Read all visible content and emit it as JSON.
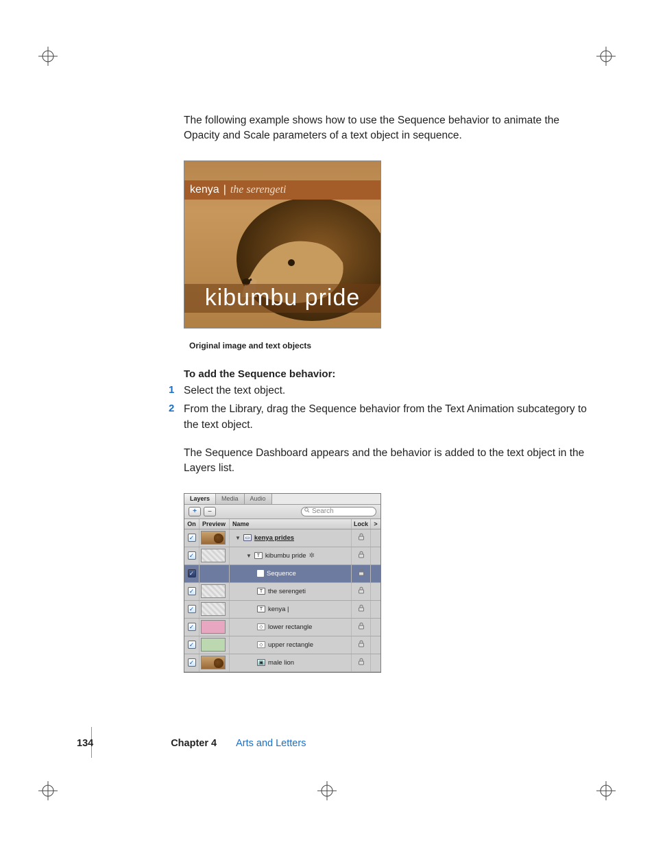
{
  "intro": "The following example shows how to use the Sequence behavior to animate the Opacity and Scale parameters of a text object in sequence.",
  "figure1": {
    "top_left": "kenya",
    "top_bar": "|",
    "top_right": "the serengeti",
    "bottom": "kibumbu pride",
    "caption": "Original image and text objects"
  },
  "heading": "To add the Sequence behavior:",
  "steps": [
    "Select the text object.",
    "From the Library, drag the Sequence behavior from the Text Animation subcategory to the text object."
  ],
  "post_para": "The Sequence Dashboard appears and the behavior is added to the text object in the Layers list.",
  "layers_panel": {
    "tabs": [
      "Layers",
      "Media",
      "Audio"
    ],
    "toolbar": {
      "add": "+",
      "remove": "–",
      "search_placeholder": "Search"
    },
    "columns": {
      "on": "On",
      "preview": "Preview",
      "name": "Name",
      "lock": "Lock",
      "more": ">"
    },
    "rows": [
      {
        "indent": 0,
        "icon": "folder",
        "name": "kenya prides",
        "thumb": "lion",
        "disclosure": true,
        "group": true,
        "selected": false
      },
      {
        "indent": 1,
        "icon": "text",
        "name": "kibumbu pride",
        "thumb": "stripe",
        "disclosure": true,
        "gear": true,
        "selected": false
      },
      {
        "indent": 2,
        "icon": "gear",
        "name": "Sequence",
        "thumb": "",
        "selected": true
      },
      {
        "indent": 2,
        "icon": "text",
        "name": "the serengeti",
        "thumb": "stripe",
        "selected": false
      },
      {
        "indent": 2,
        "icon": "text",
        "name": "kenya |",
        "thumb": "stripe",
        "selected": false
      },
      {
        "indent": 2,
        "icon": "shape",
        "name": "lower rectangle",
        "thumb": "pink",
        "selected": false
      },
      {
        "indent": 2,
        "icon": "shape",
        "name": "upper rectangle",
        "thumb": "green",
        "selected": false
      },
      {
        "indent": 2,
        "icon": "image",
        "name": "male lion",
        "thumb": "lion",
        "selected": false
      }
    ]
  },
  "footer": {
    "page": "134",
    "chapter_label": "Chapter 4",
    "chapter_name": "Arts and Letters"
  }
}
